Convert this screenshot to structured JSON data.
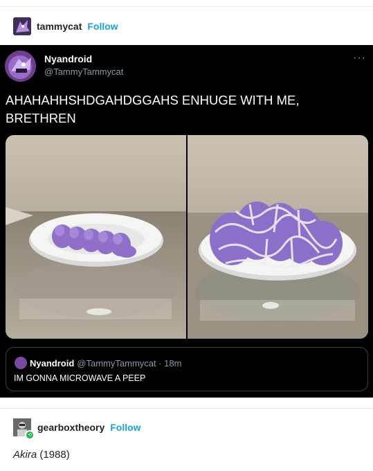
{
  "post": {
    "author": "tammycat",
    "follow_label": "Follow",
    "avatar_icon": "purple-dragon-avatar-icon"
  },
  "tweet": {
    "display_name": "Nyandroid",
    "handle": "@TammyTammycat",
    "more_label": "···",
    "text": "AHAHAHHSHDGAHDGGAHS ENHUGE WITH ME, BRETHREN",
    "photos": [
      "peeps-before-microwave-photo",
      "peeps-after-microwave-photo"
    ],
    "quote": {
      "display_name": "Nyandroid",
      "handle_time": "@TammyTammycat · 18m",
      "text": "IM GONNA MICROWAVE A PEEP"
    }
  },
  "reblog": {
    "author": "gearboxtheory",
    "follow_label": "Follow",
    "badge_icon": "reblog-icon",
    "body_title": "Akira",
    "body_year": "(1988)"
  },
  "colors": {
    "follow": "#1aa3e0",
    "tweet_bg": "#000000",
    "tweet_secondary": "#8b98a5",
    "reblog_badge": "#22b14c"
  }
}
